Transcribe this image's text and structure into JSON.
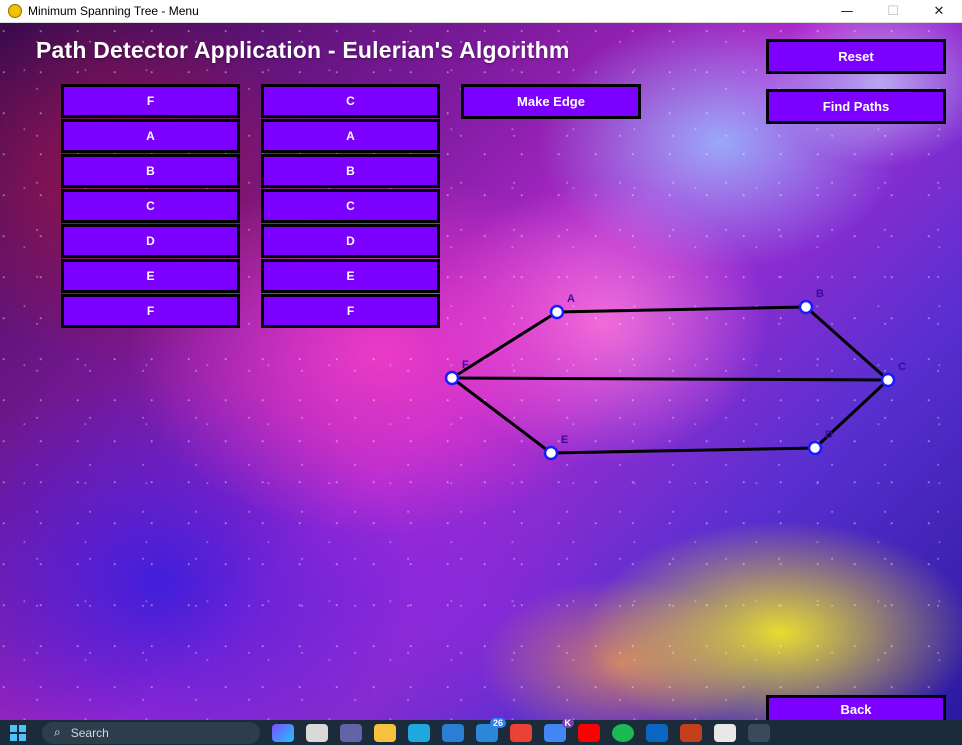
{
  "window": {
    "title": "Minimum Spanning Tree - Menu",
    "minimize_glyph": "—",
    "maximize_glyph": "☐",
    "close_glyph": "✕"
  },
  "app": {
    "title": "Path Detector Application - Eulerian's Algorithm"
  },
  "controls": {
    "reset_label": "Reset",
    "find_paths_label": "Find Paths",
    "make_edge_label": "Make Edge",
    "back_label": "Back"
  },
  "selectors": {
    "from": {
      "selected": "F",
      "options": [
        "A",
        "B",
        "C",
        "D",
        "E",
        "F"
      ]
    },
    "to": {
      "selected": "C",
      "options": [
        "A",
        "B",
        "C",
        "D",
        "E",
        "F"
      ]
    }
  },
  "graph": {
    "vertices": [
      "A",
      "B",
      "C",
      "D",
      "E",
      "F"
    ],
    "edges": [
      [
        "F",
        "A"
      ],
      [
        "A",
        "B"
      ],
      [
        "B",
        "C"
      ],
      [
        "F",
        "C"
      ],
      [
        "F",
        "E"
      ],
      [
        "E",
        "D"
      ],
      [
        "D",
        "C"
      ]
    ]
  },
  "taskbar": {
    "search_placeholder": "Search",
    "badge_count": "26",
    "profile_letter": "K"
  },
  "colors": {
    "button_fill": "#7b00ff",
    "button_border": "#000000",
    "vertex_fill": "#ffffff",
    "vertex_stroke": "#1a1aff",
    "edge_color": "#000000"
  }
}
